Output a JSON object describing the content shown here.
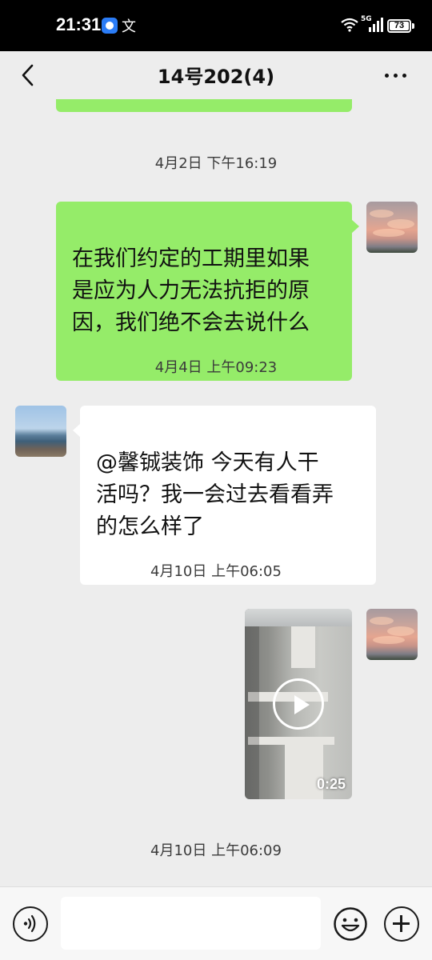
{
  "status_bar": {
    "time": "21:31",
    "notification_text": "文",
    "network": "5G",
    "battery": "73"
  },
  "nav": {
    "title": "14号202(4)"
  },
  "messages": [
    {
      "type": "timestamp",
      "text": "4月2日 下午16:19"
    },
    {
      "type": "text",
      "direction": "sent",
      "text": "在我们约定的工期里如果\n是应为人力无法抗拒的原\n因，我们绝不会去说什么"
    },
    {
      "type": "timestamp",
      "text": "4月4日 上午09:23"
    },
    {
      "type": "text",
      "direction": "received",
      "text": "@馨铖装饰  今天有人干\n活吗？我一会过去看看弄\n的怎么样了"
    },
    {
      "type": "timestamp",
      "text": "4月10日 上午06:05"
    },
    {
      "type": "video",
      "direction": "sent",
      "duration": "0:25"
    },
    {
      "type": "timestamp",
      "text": "4月10日 上午06:09"
    }
  ],
  "input": {
    "placeholder": ""
  },
  "icons": {
    "back": "chevron-left-icon",
    "more": "more-dots-icon",
    "voice": "voice-icon",
    "emoji": "emoji-icon",
    "plus": "plus-icon",
    "play": "play-icon"
  },
  "colors": {
    "sent_bubble": "#95ec69",
    "received_bubble": "#ffffff",
    "chat_background": "#ededed"
  }
}
